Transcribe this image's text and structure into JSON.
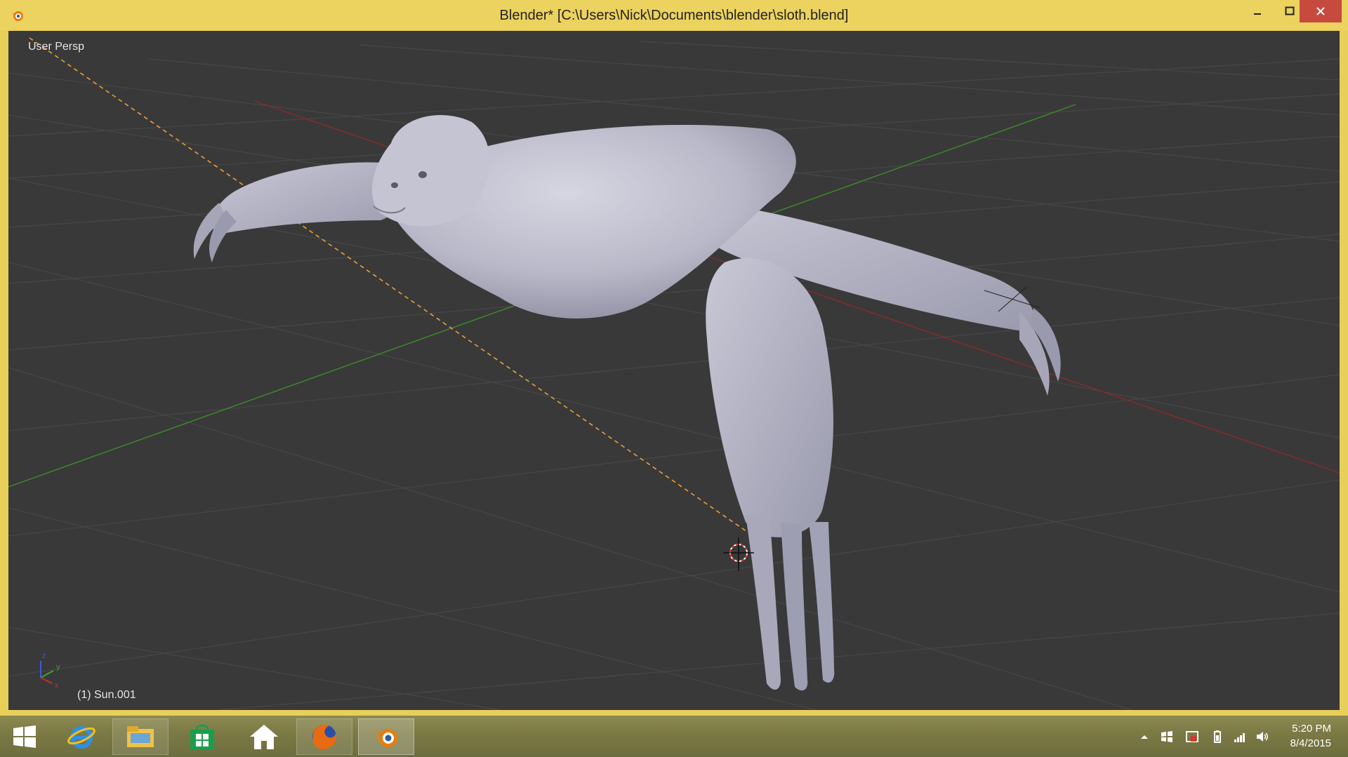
{
  "window": {
    "title": "Blender* [C:\\Users\\Nick\\Documents\\blender\\sloth.blend]",
    "app_icon": "blender-icon",
    "controls": [
      "minimize-icon",
      "maximize-icon",
      "close-icon"
    ]
  },
  "viewport": {
    "view_label": "User Persp",
    "object_label": "(1) Sun.001",
    "axis_widget": {
      "x": "x",
      "y": "y",
      "z": "z"
    },
    "colors": {
      "background": "#393939",
      "grid": "#4a4a4a",
      "x_axis": "#8c2a2a",
      "y_axis": "#3e8c2a",
      "selection_dash": "#e8a03c"
    }
  },
  "taskbar": {
    "items": [
      {
        "name": "start-button",
        "icon": "windows-logo-icon"
      },
      {
        "name": "internet-explorer",
        "icon": "internet-explorer-icon"
      },
      {
        "name": "file-explorer",
        "icon": "folder-icon"
      },
      {
        "name": "store",
        "icon": "store-icon"
      },
      {
        "name": "home",
        "icon": "home-icon"
      },
      {
        "name": "firefox",
        "icon": "firefox-icon"
      },
      {
        "name": "blender",
        "icon": "blender-icon"
      }
    ],
    "tray": [
      "show-hidden-icons-chevron",
      "flag-icon",
      "network-shield-icon",
      "battery-icon",
      "signal-icon",
      "volume-icon"
    ],
    "clock": {
      "time": "5:20 PM",
      "date": "8/4/2015"
    }
  }
}
